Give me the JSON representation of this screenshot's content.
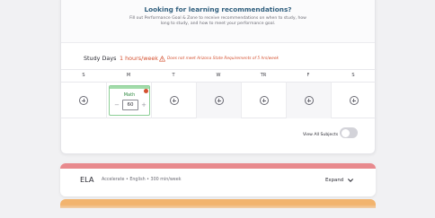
{
  "recommendations": {
    "title": "Looking for learning recommendations?",
    "subtitle": "Fill out Performance Goal & Zone to receive recommendations on when to study, how long to study, and how to meet your performance goal."
  },
  "study": {
    "label": "Study Days",
    "hours": "1 hours/week",
    "warning": "Does not meet Arizona State Requirements of 5 hrs/week",
    "colors": {
      "warning": "#d4502f"
    }
  },
  "days": [
    {
      "label": "S",
      "shaded": false
    },
    {
      "label": "M",
      "shaded": false
    },
    {
      "label": "T",
      "shaded": false
    },
    {
      "label": "W",
      "shaded": true
    },
    {
      "label": "TR",
      "shaded": false
    },
    {
      "label": "F",
      "shaded": true
    },
    {
      "label": "S",
      "shaded": false
    }
  ],
  "scheduled": {
    "subject": "Math",
    "minutes": "60",
    "minus": "−",
    "plus": "+",
    "colors": {
      "accent": "#2f8a41"
    }
  },
  "footer": {
    "view_all": "View All Subjects",
    "toggle_on": false
  },
  "ela": {
    "name": "ELA",
    "meta": "Accelerate • English • 300 min/week",
    "expand": "Expand",
    "colors": {
      "band": "#e88a8e"
    }
  },
  "next_card": {
    "colors": {
      "band": "#f2b46e"
    }
  }
}
